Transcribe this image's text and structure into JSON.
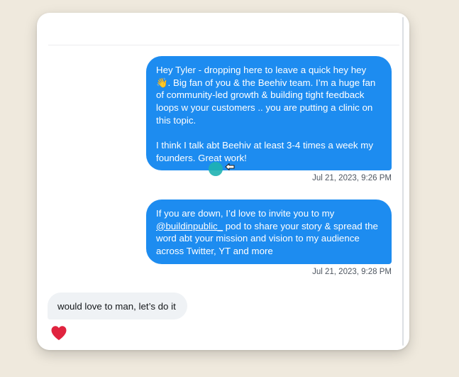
{
  "conversation": {
    "messages": [
      {
        "direction": "outgoing",
        "paragraphs": [
          "Hey Tyler - dropping here to leave a quick hey hey 👋. Big fan of you & the Beehiv team. I’m a huge fan of community-led growth & building tight feedback loops w your customers .. you are putting a clinic on this topic.",
          "I think I talk abt Beehiv at least 3-4 times a week my founders. Great work!"
        ],
        "timestamp": "Jul 21, 2023, 9:26 PM"
      },
      {
        "direction": "outgoing",
        "text_before": "If you are down, I’d love to invite you to my ",
        "mention": "@buildinpublic_",
        "text_after": " pod to share your story & spread the word abt your mission and vision to my audience across Twitter, YT and more",
        "timestamp": "Jul 21, 2023, 9:28 PM"
      },
      {
        "direction": "incoming",
        "text": "would love to man, let’s do it",
        "reaction": "heart-icon"
      }
    ]
  },
  "colors": {
    "outgoing_bubble": "#1d8cf0",
    "incoming_bubble": "#eff2f5",
    "background": "#efe9dd",
    "reaction_heart": "#e0233e",
    "cursor_dot": "#1fb3b1"
  }
}
